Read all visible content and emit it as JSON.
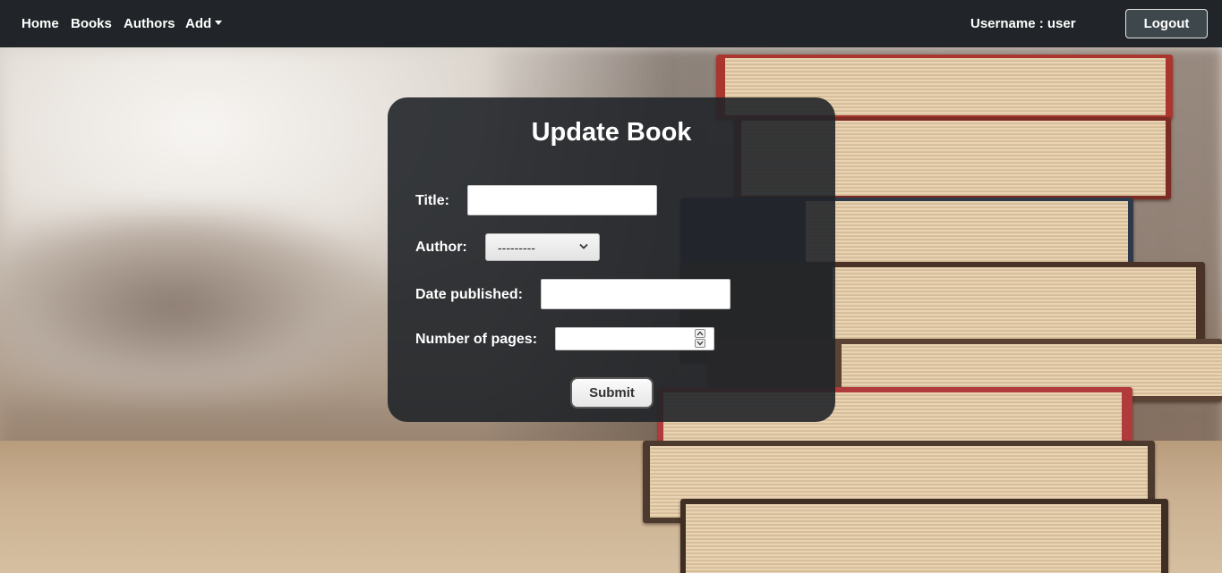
{
  "nav": {
    "home": "Home",
    "books": "Books",
    "authors": "Authors",
    "add": "Add",
    "username": "Username : user",
    "logout": "Logout"
  },
  "form": {
    "title": "Update Book",
    "fields": {
      "title_label": "Title:",
      "title_value": "",
      "author_label": "Author:",
      "author_selected": "---------",
      "date_label": "Date published:",
      "date_value": "",
      "pages_label": "Number of pages:",
      "pages_value": ""
    },
    "submit": "Submit"
  },
  "colors": {
    "navbar": "#212529",
    "card": "#212529",
    "logout_bg": "#3d474c"
  },
  "background": "stack of old books on a wooden table"
}
